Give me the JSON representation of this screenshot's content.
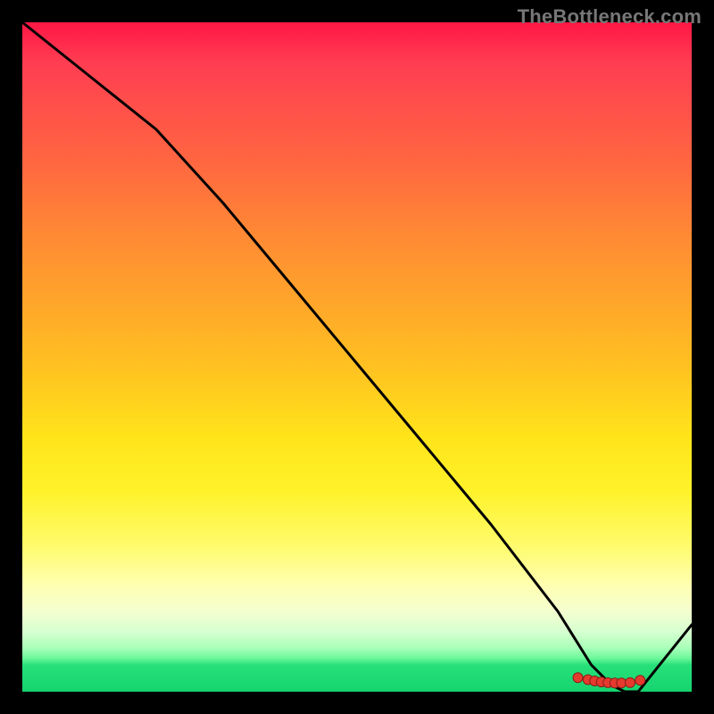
{
  "watermark": "TheBottleneck.com",
  "colors": {
    "curve_stroke": "#000000",
    "marker_fill": "#e63a2e",
    "marker_stroke": "#8a1f17"
  },
  "chart_data": {
    "type": "line",
    "title": "",
    "xlabel": "",
    "ylabel": "",
    "xlim": [
      0,
      100
    ],
    "ylim": [
      0,
      100
    ],
    "grid": false,
    "legend": false,
    "series": [
      {
        "name": "bottleneck-curve",
        "x": [
          0,
          10,
          20,
          30,
          40,
          50,
          60,
          70,
          80,
          85,
          88,
          90,
          92,
          100
        ],
        "y": [
          100,
          92,
          84,
          73,
          61,
          49,
          37,
          25,
          12,
          4,
          1,
          0,
          0,
          10
        ]
      }
    ],
    "markers": {
      "name": "optimum-band",
      "x": [
        83,
        84.5,
        85.5,
        86.5,
        87.5,
        88.5,
        89.5,
        90.8,
        92.3
      ],
      "y": [
        2.1,
        1.8,
        1.6,
        1.45,
        1.35,
        1.3,
        1.3,
        1.35,
        1.7
      ]
    }
  }
}
